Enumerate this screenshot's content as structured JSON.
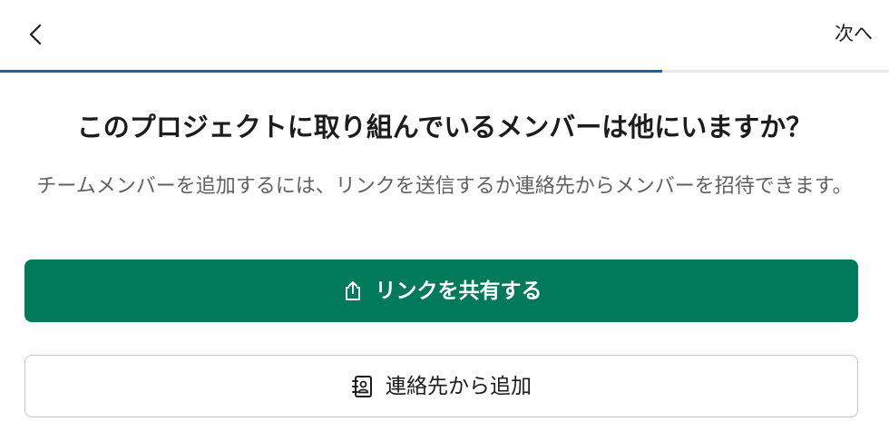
{
  "header": {
    "back_icon": "chevron-left-icon",
    "next_label": "次へ"
  },
  "progress": {
    "fraction": 0.745,
    "color": "#1264a3"
  },
  "main": {
    "title": "このプロジェクトに取り組んでいるメンバーは他にいますか？",
    "subtitle": "チームメンバーを追加するには、リンクを送信するか連絡先からメンバーを招待できます。"
  },
  "actions": {
    "share_link": {
      "label": "リンクを共有する",
      "icon": "share-icon",
      "color": "#007a5a"
    },
    "add_from_contacts": {
      "label": "連絡先から追加",
      "icon": "contacts-icon"
    }
  }
}
